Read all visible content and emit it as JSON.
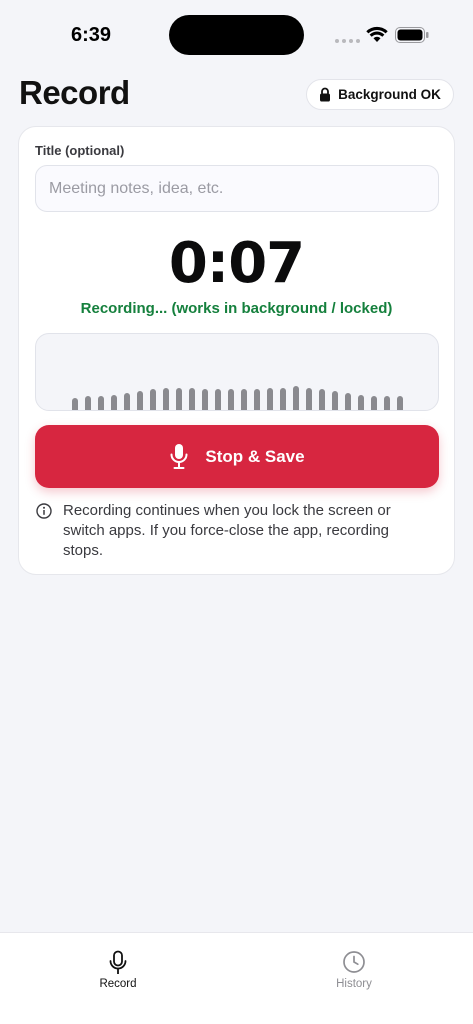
{
  "status_bar": {
    "time": "6:39"
  },
  "header": {
    "title": "Record",
    "background_badge": "Background OK"
  },
  "form": {
    "title_label": "Title (optional)",
    "title_placeholder": "Meeting notes, idea, etc.",
    "title_value": ""
  },
  "recorder": {
    "elapsed": "0:07",
    "status": "Recording... (works in background / locked)",
    "waveform_levels": [
      0.35,
      0.4,
      0.4,
      0.45,
      0.5,
      0.55,
      0.6,
      0.65,
      0.65,
      0.65,
      0.6,
      0.6,
      0.6,
      0.6,
      0.6,
      0.65,
      0.65,
      0.7,
      0.65,
      0.6,
      0.55,
      0.5,
      0.45,
      0.4,
      0.4,
      0.4
    ],
    "stop_label": "Stop & Save",
    "info_text": "Recording continues when you lock the screen or switch apps. If you force-close the app, recording stops."
  },
  "tabs": [
    {
      "label": "Record",
      "icon": "mic-icon",
      "active": true
    },
    {
      "label": "History",
      "icon": "clock-icon",
      "active": false
    }
  ],
  "colors": {
    "accent_red": "#d72640",
    "recording_green": "#15803d",
    "background": "#f4f5f9"
  }
}
